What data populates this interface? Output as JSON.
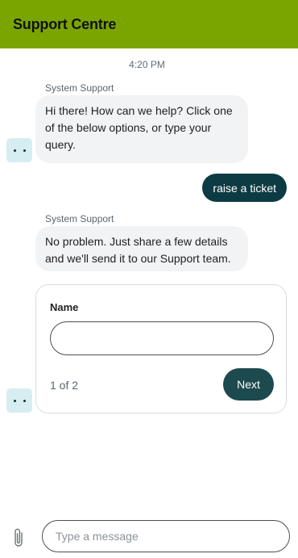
{
  "header": {
    "title": "Support Centre"
  },
  "chat": {
    "timestamp": "4:20 PM",
    "messages": [
      {
        "sender": "System Support",
        "text": "Hi there! How can we help? Click one of the below options, or type your query."
      },
      {
        "user_text": "raise a ticket"
      },
      {
        "sender": "System Support",
        "text": "No problem. Just share a few details and we'll send it to our Support team."
      }
    ],
    "form": {
      "field_label": "Name",
      "field_value": "",
      "pagination": "1 of 2",
      "next_label": "Next"
    }
  },
  "composer": {
    "placeholder": "Type a message",
    "attach_icon": "paperclip-icon"
  },
  "colors": {
    "header_bg": "#7aa500",
    "user_bubble": "#0d3b44",
    "next_button": "#1d4a4e",
    "bot_bubble": "#f2f3f5",
    "avatar_bg": "#d6eef2"
  }
}
